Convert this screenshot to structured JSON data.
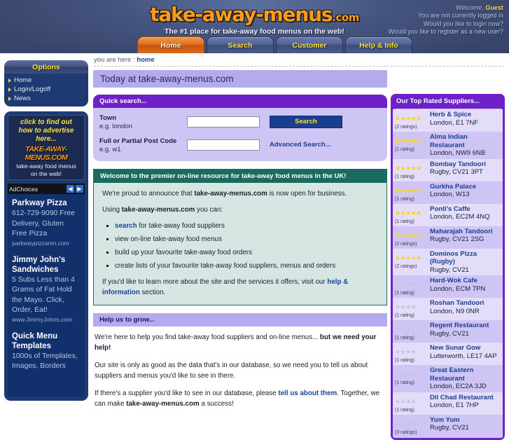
{
  "header": {
    "logo_text": "take-away-menus",
    "logo_tld": ".com",
    "tagline": "The #1 place for take-away food menus on the web!",
    "welcome_prefix": "Welcome, ",
    "welcome_user": "Guest",
    "status_line": "You are not currently logged in",
    "login_prompt": "Would you like to login now?",
    "register_prompt": "Would you like to register as a new user?",
    "tabs": [
      {
        "label": "Home",
        "active": true
      },
      {
        "label": "Search",
        "active": false
      },
      {
        "label": "Customer",
        "active": false
      },
      {
        "label": "Help & Info",
        "active": false
      }
    ]
  },
  "breadcrumb": {
    "prefix": "you are here : ",
    "current": "home"
  },
  "sidebar": {
    "options_title": "Options",
    "items": [
      {
        "label": "Home"
      },
      {
        "label": "Login/Logoff"
      },
      {
        "label": "News"
      }
    ],
    "advert": {
      "line1": "click to find out",
      "line2": "how to advertise",
      "line3": "here...",
      "logo": "TAKE-AWAY-MENUS.COM",
      "sub1": "take-away food menus",
      "sub2": "on the web!"
    },
    "adchoices": {
      "label": "AdChoices",
      "prev": "◀",
      "next": "▶"
    },
    "ads": [
      {
        "title": "Parkway Pizza",
        "desc": "612-729-9090 Free Delivery, Gluten Free Pizza",
        "url": "parkwaypizzamn.com"
      },
      {
        "title_line1": "Jimmy John's",
        "title_line2": "Sandwiches",
        "desc": "5 Subs Less than 4 Grams of Fat Hold the Mayo. Click, Order, Eat!",
        "url": "www.JimmyJohns.com"
      },
      {
        "title_line1": "Quick Menu",
        "title_line2": "Templates",
        "desc": "1000s of Templates, Images, Borders"
      }
    ]
  },
  "main": {
    "today_title": "Today at take-away-menus.com",
    "quick_search": {
      "title": "Quick search...",
      "town_label": "Town",
      "town_eg": "e.g. london",
      "town_value": "",
      "town_placeholder": "",
      "postcode_label": "Full or Partial Post Code",
      "postcode_eg": "e.g. w1",
      "postcode_value": "",
      "postcode_placeholder": "",
      "search_button": "Search",
      "advanced_link": "Advanced Search..."
    },
    "welcome": {
      "title": "Welcome to the premier on-line resource for take-away food menus in the UK!",
      "p1_a": "We're proud to announce that ",
      "p1_b": "take-away-menus.com",
      "p1_c": " is now open for business.",
      "p2_a": "Using ",
      "p2_b": "take-away-menus.com",
      "p2_c": " you can:",
      "bullet1_link": "search",
      "bullet1_rest": " for take-away food suppliers",
      "bullet2": "view on-line take-away food menus",
      "bullet3": "build up your favourite take-away food orders",
      "bullet4": "create lists of your favourite take-away food suppliers, menus and orders",
      "p3_a": "If you'd like to learn more about the site and the services it offers, visit our ",
      "p3_link": "help & information",
      "p3_b": " section."
    },
    "grow": {
      "title": "Help us to grow...",
      "p1_a": "We're here to help you find take-away food suppliers and on-line menus... ",
      "p1_b": "but we need your help!",
      "p2": "Our site is only as good as the data that's in our database, so we need you to tell us about suppliers and menus you'd like to see in there.",
      "p3_a": "If there's a supplier you'd like to see in our database, please ",
      "p3_link": "tell us about them",
      "p3_b": ". Together, we can make ",
      "p3_c": "take-away-menus.com",
      "p3_d": " a success!"
    }
  },
  "suppliers": {
    "title": "Our Top Rated Suppliers...",
    "items": [
      {
        "stars": 5,
        "dim": false,
        "count": "(2 ratings)",
        "name": "Herb & Spice",
        "location": "London, E1 7NF"
      },
      {
        "stars": 5,
        "dim": false,
        "count": "(1 rating)",
        "name": "Alma Indian Restaurant",
        "location": "London, NW9 6NB"
      },
      {
        "stars": 5,
        "dim": false,
        "count": "(1 rating)",
        "name": "Bombay Tandoori",
        "location": "Rugby, CV21 3PT"
      },
      {
        "stars": 5,
        "dim": false,
        "count": "(1 rating)",
        "name": "Gurkha Palace",
        "location": "London, W13"
      },
      {
        "stars": 5,
        "dim": false,
        "count": "(1 rating)",
        "name": "Ponti's Caffe",
        "location": "London, EC2M 4NQ"
      },
      {
        "stars": 5,
        "dim": false,
        "count": "(2 ratings)",
        "name": "Maharajah Tandoori",
        "location": "Rugby, CV21 2SG"
      },
      {
        "stars": 5,
        "dim": false,
        "count": "(2 ratings)",
        "name": "Dominos Pizza (Rugby)",
        "location": "Rugby, CV21"
      },
      {
        "stars": 4,
        "dim": true,
        "count": "(1 rating)",
        "name": "Hard-Wok Cafe",
        "location": "London, ECM 7PN"
      },
      {
        "stars": 4,
        "dim": true,
        "count": "(1 rating)",
        "name": "Roshan Tandoori",
        "location": "London, N9 0NR"
      },
      {
        "stars": 4,
        "dim": true,
        "count": "(1 rating)",
        "name": "Regent Restaurant",
        "location": "Rugby, CV21"
      },
      {
        "stars": 4,
        "dim": true,
        "count": "(1 rating)",
        "name": "New Sunar Gow",
        "location": "Lutterworth, LE17 4AP"
      },
      {
        "stars": 4,
        "dim": true,
        "count": "(1 rating)",
        "name": "Great Eastern Restaurant",
        "location": "London, EC2A 3JD"
      },
      {
        "stars": 4,
        "dim": true,
        "count": "(1 rating)",
        "name": "Dil Chad Restaurant",
        "location": "London, E1 7HP"
      },
      {
        "stars": 4,
        "dim": true,
        "count": "(3 ratings)",
        "name": "Yum Yum",
        "location": "Rugby, CV21"
      }
    ]
  },
  "colors": {
    "header_blue": "#3a4871",
    "accent_orange": "#ff9b1a",
    "tab_yellow": "#ffe033",
    "purple": "#6e21c8",
    "lilac": "#cfc5f5",
    "teal": "#1c6b61",
    "link_blue": "#1b3f8f",
    "star_gold": "#ffd400"
  }
}
